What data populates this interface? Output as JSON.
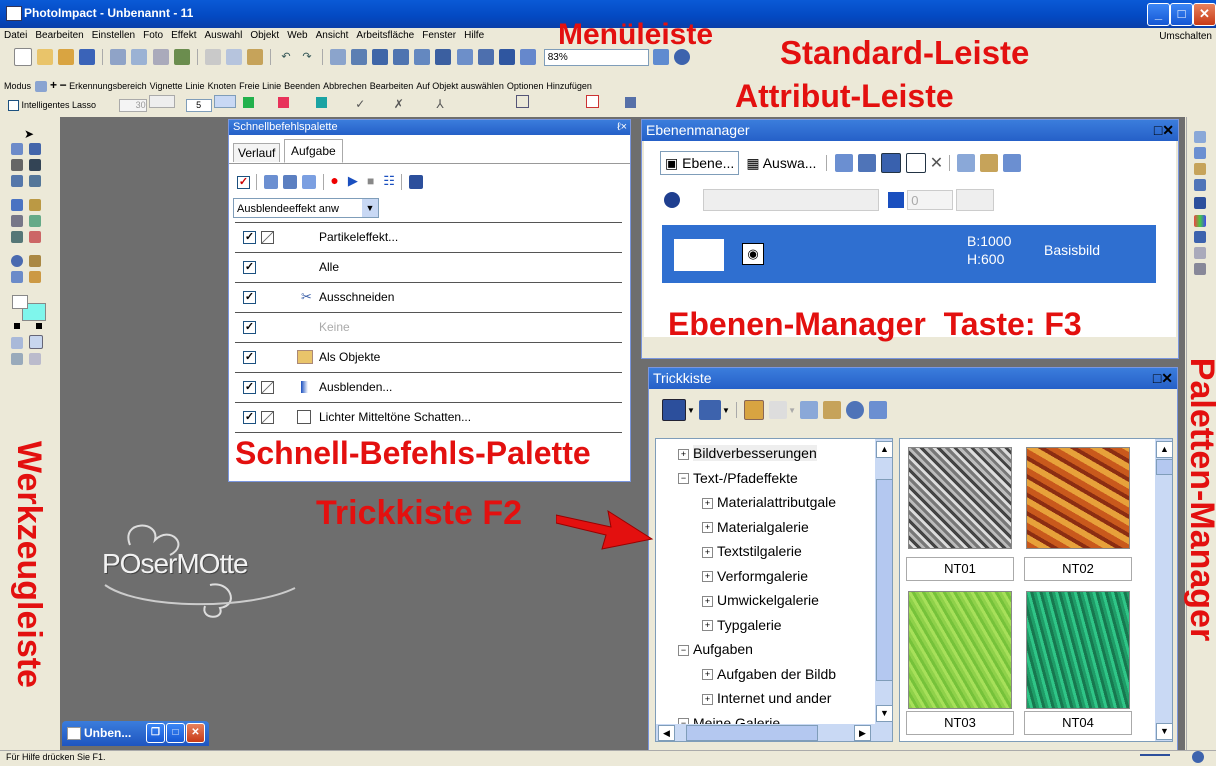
{
  "window": {
    "title": "PhotoImpact - Unbenannt - 11",
    "umschalten": "Umschalten"
  },
  "menu": [
    "Datei",
    "Bearbeiten",
    "Einstellen",
    "Foto",
    "Effekt",
    "Auswahl",
    "Objekt",
    "Web",
    "Ansicht",
    "Arbeitsfläche",
    "Fenster",
    "Hilfe"
  ],
  "standard_toolbar": {
    "zoom": "83%"
  },
  "attribute_toolbar": {
    "modus": "Modus",
    "items": [
      "Erkennungsbereich",
      "Vignette",
      "Linie",
      "Knoten",
      "Freie Linie",
      "Beenden",
      "Abbrechen",
      "Bearbeiten",
      "Auf Objekt auswählen",
      "Optionen",
      "Hinzufügen"
    ],
    "lasso": "Intelligentes Lasso",
    "val1": "30",
    "val2": "5"
  },
  "annotations": {
    "menu": "Menüleiste",
    "standard": "Standard-Leiste",
    "attribute": "Attribut-Leiste",
    "tools": "Werkzeugleiste",
    "quick": "Schnell-Befehls-Palette",
    "trickbox": "Trickkiste F2",
    "layers": "Ebenen-Manager  Taste: F3",
    "palette": "Paletten-Manager"
  },
  "quick_palette": {
    "title": "Schnellbefehlspalette",
    "tabs": [
      "Verlauf",
      "Aufgabe"
    ],
    "dropdown": "Ausblendeeffekt anw",
    "rows": [
      "Partikeleffekt...",
      "Alle",
      "Ausschneiden",
      "Keine",
      "Als Objekte",
      "Ausblenden...",
      "Lichter Mitteltöne Schatten..."
    ]
  },
  "logo_text": "POserMOtte",
  "minimized_doc": "Unben...",
  "layer_manager": {
    "title": "Ebenenmanager",
    "btn1": "Ebene...",
    "btn2": "Auswa...",
    "opacity": "0",
    "layer": {
      "b": "B:1000",
      "h": "H:600",
      "name": "Basisbild"
    }
  },
  "trickbox": {
    "title": "Trickkiste",
    "tree": [
      {
        "label": "Bildverbesserungen",
        "sign": "+",
        "indent": 0
      },
      {
        "label": "Text-/Pfadeffekte",
        "sign": "−",
        "indent": 0
      },
      {
        "label": "Materialattributgale",
        "sign": "+",
        "indent": 1
      },
      {
        "label": "Materialgalerie",
        "sign": "+",
        "indent": 1
      },
      {
        "label": "Textstilgalerie",
        "sign": "+",
        "indent": 1
      },
      {
        "label": "Verformgalerie",
        "sign": "+",
        "indent": 1
      },
      {
        "label": "Umwickelgalerie",
        "sign": "+",
        "indent": 1
      },
      {
        "label": "Typgalerie",
        "sign": "+",
        "indent": 1
      },
      {
        "label": "Aufgaben",
        "sign": "−",
        "indent": 0
      },
      {
        "label": "Aufgaben der Bildb",
        "sign": "+",
        "indent": 1
      },
      {
        "label": "Internet und ander",
        "sign": "+",
        "indent": 1
      },
      {
        "label": "Meine Galerie",
        "sign": "−",
        "indent": 0
      }
    ],
    "thumbs": [
      "NT01",
      "NT02",
      "NT03",
      "NT04"
    ]
  },
  "status": "Für Hilfe drücken Sie F1.",
  "colors": {
    "title_blue": "#0a5ad6",
    "panel_blue": "#2f6fd0",
    "annotation_red": "#e3100f",
    "workspace": "#6e6e6e"
  }
}
